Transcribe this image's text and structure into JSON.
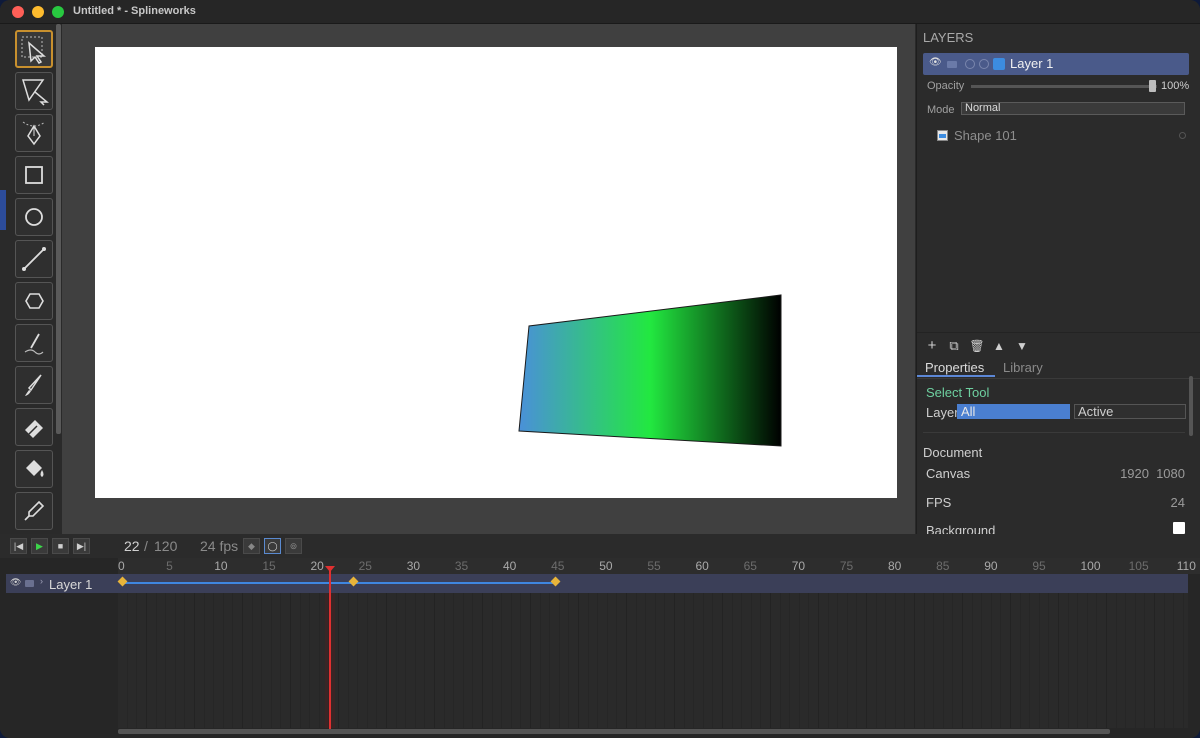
{
  "window": {
    "title": "Untitled * - Splineworks"
  },
  "tools": [
    "select-tool",
    "node-edit-tool",
    "pen-tool",
    "rectangle-tool",
    "ellipse-tool",
    "line-tool",
    "polygon-tool",
    "pencil-tool",
    "brush-tool",
    "eraser-tool",
    "paint-bucket-tool",
    "eyedropper-tool"
  ],
  "layers_panel": {
    "header": "LAYERS",
    "layer": {
      "name": "Layer 1",
      "color": "#3c8ce0"
    },
    "opacity_label": "Opacity",
    "opacity_value": "100%",
    "opacity": 1.0,
    "mode_label": "Mode",
    "mode_value": "Normal",
    "shape": {
      "name": "Shape 101"
    },
    "buttons": {
      "add": "+",
      "duplicate": "⧉",
      "delete": "🗑",
      "up": "▲",
      "down": "▼"
    }
  },
  "properties": {
    "tabs": [
      "Properties",
      "Library"
    ],
    "tool_name": "Select Tool",
    "layer_label": "Layer",
    "layer_options": [
      "All",
      "Active"
    ],
    "document_header": "Document",
    "canvas_label": "Canvas",
    "canvas_w": "1920",
    "canvas_h": "1080",
    "fps_label": "FPS",
    "fps_value": "24",
    "background_label": "Background",
    "background_color": "#ffffff"
  },
  "transport": {
    "current_frame": "22",
    "slash": "/",
    "total_frames": "120",
    "fps": "24 fps"
  },
  "timeline": {
    "ruler_ticks": [
      "0",
      "5",
      "10",
      "15",
      "20",
      "25",
      "30",
      "35",
      "40",
      "45",
      "50",
      "55",
      "60",
      "65",
      "70",
      "75",
      "80",
      "85",
      "90",
      "95",
      "100",
      "105",
      "110"
    ],
    "layer_name": "Layer 1",
    "keyframes": [
      0,
      24,
      45
    ],
    "playhead_frame": 22
  },
  "shape_gradient": [
    "#4a90d9",
    "#22e840",
    "#000000"
  ]
}
